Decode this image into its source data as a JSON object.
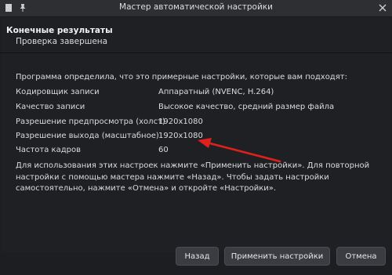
{
  "window": {
    "title": "Мастер автоматической настройки",
    "close_symbol": "✕",
    "pin_symbol": "📌",
    "app_symbol": "▪"
  },
  "page": {
    "heading": "Конечные результаты",
    "subheading": "Проверка завершена",
    "intro": "Программа определила, что это примерные настройки, которые вам подходят:",
    "settings": [
      {
        "label": "Кодировщик записи",
        "value": "Аппаратный (NVENC, H.264)"
      },
      {
        "label": "Качество записи",
        "value": "Высокое качество, средний размер файла"
      },
      {
        "label": "Разрешение предпросмотра (холст)",
        "value": "1920x1080"
      },
      {
        "label": "Разрешение выхода (масштабное)",
        "value": "1920x1080"
      },
      {
        "label": "Частота кадров",
        "value": "60"
      }
    ],
    "note": "Для использования этих настроек нажмите «Применить настройки». Для повторной настройки с помощью мастера нажмите «Назад». Чтобы задать настройки самостоятельно, нажмите «Отмена» и откройте «Настройки»."
  },
  "buttons": {
    "back": "Назад",
    "apply": "Применить настройки",
    "cancel": "Отмена"
  },
  "colors": {
    "annotation_arrow": "#e0201c",
    "background": "#1d1e22",
    "button": "#3b3c41"
  }
}
